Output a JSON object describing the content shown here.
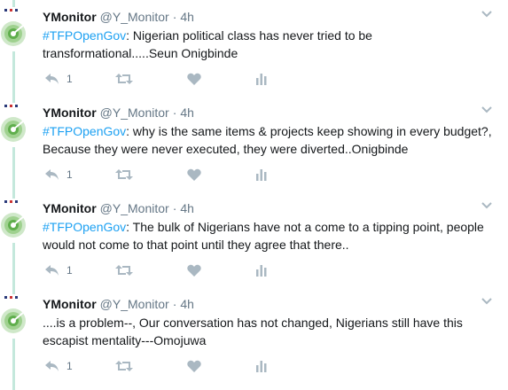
{
  "colors": {
    "hashtag": "#1da1f2",
    "muted": "#657786",
    "icon": "#aab8c2",
    "thread_line": "#c4e8dc"
  },
  "icons": {
    "avatar": "ymonitor-logo",
    "caret": "chevron-down-icon",
    "reply": "reply-icon",
    "retweet": "retweet-icon",
    "like": "heart-icon",
    "analytics": "analytics-icon"
  },
  "tweets": [
    {
      "name": "YMonitor",
      "handle": "@Y_Monitor",
      "separator": "·",
      "time": "4h",
      "hashtag": "#TFPOpenGov",
      "text": ": Nigerian political class has never tried to be transformational.....Seun Onigbinde",
      "reply_count": "1"
    },
    {
      "name": "YMonitor",
      "handle": "@Y_Monitor",
      "separator": "·",
      "time": "4h",
      "hashtag": "#TFPOpenGov",
      "text": ": why is the same items & projects keep showing in every budget?, Because they were never executed, they were diverted..Onigbinde",
      "reply_count": "1"
    },
    {
      "name": "YMonitor",
      "handle": "@Y_Monitor",
      "separator": "·",
      "time": "4h",
      "hashtag": "#TFPOpenGov",
      "text": ": The bulk of Nigerians have not a come to a tipping point, people would not come to that point until they agree that there..",
      "reply_count": "1"
    },
    {
      "name": "YMonitor",
      "handle": "@Y_Monitor",
      "separator": "·",
      "time": "4h",
      "hashtag": "",
      "text": "....is a problem--, Our conversation has not changed, Nigerians still have this escapist mentality---Omojuwa",
      "reply_count": "1"
    }
  ]
}
